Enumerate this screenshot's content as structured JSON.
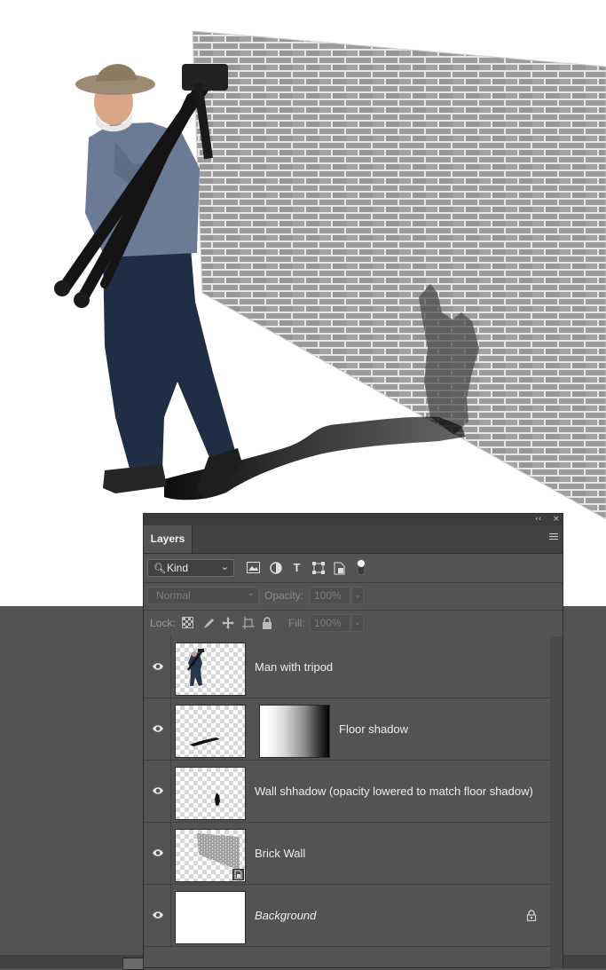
{
  "panel": {
    "tab_label": "Layers",
    "collapse_glyph": "‹‹",
    "close_glyph": "×",
    "filter": {
      "kind_label": "Kind",
      "icons": [
        "image-filter-icon",
        "adjustment-filter-icon",
        "type-filter-icon",
        "shape-filter-icon",
        "smart-object-filter-icon",
        "filter-toggle-icon"
      ]
    },
    "blend": {
      "mode": "Normal",
      "opacity_label": "Opacity:",
      "opacity_value": "100%"
    },
    "lock": {
      "label": "Lock:",
      "fill_label": "Fill:",
      "fill_value": "100%"
    }
  },
  "layers": [
    {
      "name": "Man with tripod",
      "visible": true
    },
    {
      "name": "Floor shadow",
      "visible": true,
      "has_mask": true
    },
    {
      "name": "Wall shhadow (opacity lowered to match floor shadow)",
      "visible": true
    },
    {
      "name": "Brick Wall",
      "visible": true,
      "smart_object": true
    },
    {
      "name": "Background",
      "visible": true,
      "locked": true
    }
  ],
  "colors": {
    "panel_bg": "#535353",
    "canvas_bg": "#ffffff",
    "brick": "#9a9a9a",
    "mortar": "#e4e4e4",
    "shadow": "#1a1a1a",
    "jeans": "#1f2e45",
    "shirt": "#6b7b95"
  }
}
